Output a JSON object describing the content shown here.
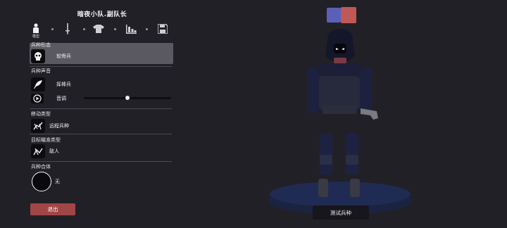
{
  "header": {
    "title": "暗夜小队.副队长"
  },
  "tabs": {
    "model_label": "模型"
  },
  "sections": {
    "form": {
      "label": "兵种形态",
      "value": "软骨兵"
    },
    "voice": {
      "label": "兵种声音",
      "value": "挥棒兵",
      "pitch_label": "音调",
      "pitch_level": 0.5
    },
    "movement": {
      "label": "移动类型",
      "value": "远程兵种"
    },
    "targeting": {
      "label": "目标瞄准类型",
      "value": "敌人"
    },
    "combine": {
      "label": "兵种合体",
      "value": "无"
    }
  },
  "buttons": {
    "exit": "退出",
    "test": "测试兵种"
  },
  "colors": {
    "team_blue": "#5a60b8",
    "team_red": "#c05858",
    "exit_button": "#a14646",
    "background": "#222027"
  }
}
